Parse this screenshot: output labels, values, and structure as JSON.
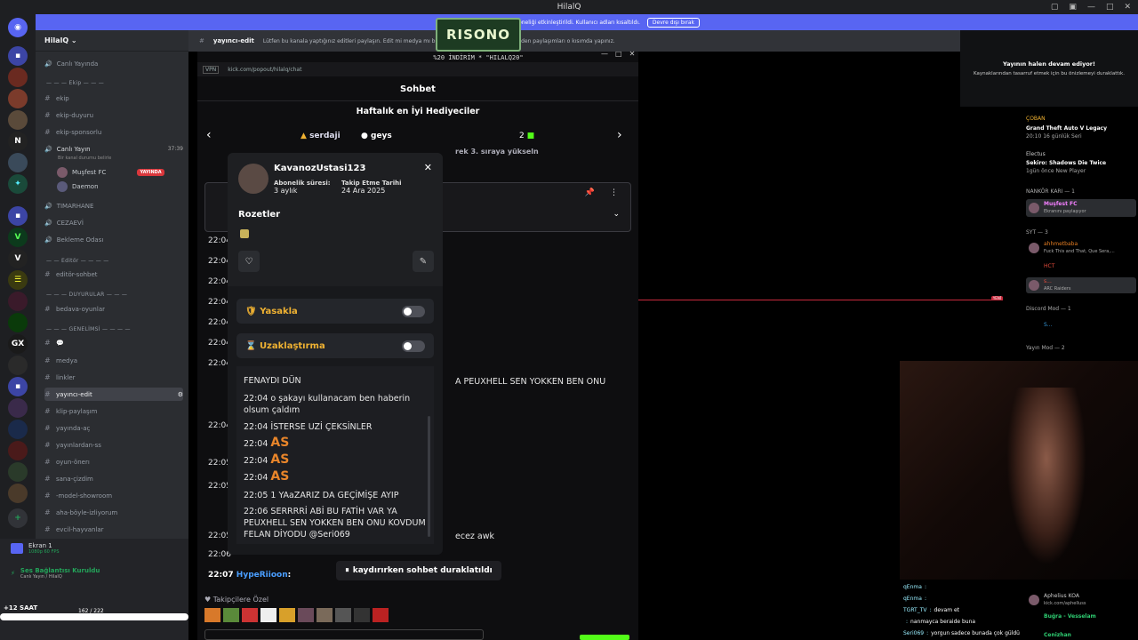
{
  "window": {
    "title": "HilalQ"
  },
  "banner": {
    "text": "Sunucunuzun aboneliği etkinleştirildi. Kullanıcı adları kısaltıldı.",
    "button": "Devre dışı bırak"
  },
  "server": {
    "name": "HilalQ"
  },
  "channels": {
    "live_header": "Canlı Yayında",
    "cat_ekip": "Ekip",
    "ekip": "ekip",
    "ekip_duyuru": "ekip-duyuru",
    "ekip_sponsorlu": "ekip-sponsorlu",
    "canli_yayin": "Canlı Yayın",
    "canli_yayin_sub": "Bir kanal durumu belirle",
    "canli_yayin_time": "37:39",
    "user1": "Muşfest FC",
    "user1_badge": "YAYINDA",
    "user2": "Daemon",
    "timarhane": "TIMARHANE",
    "cezaevi": "CEZAEVİ",
    "bekleme": "Bekleme Odası",
    "cat_editor": "Editör",
    "editor_sohbet": "editör-sohbet",
    "cat_duyurular": "DUYURULAR",
    "bedava": "bedava-oyunlar",
    "cat_genel": "GENELİMSİ",
    "medya": "medya",
    "linkler": "linkler",
    "yayinci_edit": "yayıncı-edit",
    "klip": "klip-paylaşım",
    "yayinda_ac": "yayında-aç",
    "yayinlardan": "yayınlardan-ss",
    "oyun_oneri": "oyun-önerı",
    "sana_cizdim": "sana-çizdim",
    "model": "-model-showroom",
    "aha": "aha-böyle-izliyorum",
    "evcil": "evcil-hayvanlar"
  },
  "user_panel": {
    "screen": "Ekran 1",
    "screen_sub": "1080p 60 FPS",
    "voice": "Ses Bağlantısı Kuruldu",
    "voice_sub": "Canlı Yayın / HilalQ",
    "timer_label": "+12 SAAT",
    "count": "162 / 222"
  },
  "topbar": {
    "channel": "yayıncı-edit",
    "topic": "Lütfen bu kanala yaptığınız editleri paylaşın. Edit mi medya mı büyük ihtimalle medyadır. Bu yüzden paylaşımları o kısımda yapınız."
  },
  "browser": {
    "url": "kick.com/popout/hilalq/chat"
  },
  "overlay": {
    "logo_text": "RISONO",
    "promo": "%20 İNDİRİM * \"HILALQ20\""
  },
  "chat": {
    "title": "Sohbet",
    "gifters_title": "Haftalık en İyi Hediyeciler",
    "gifter1": "serdaji",
    "gifter2": "geys",
    "gifter3_count": "2",
    "gifter_sub": "rek 3. sıraya yükseln",
    "paused": "kaydırırken sohbet duraklatıldı",
    "last_time": "22:07",
    "last_user": "HypeRiioon",
    "followers_only": "Takipçilere Özel",
    "right_line1": "A PEUXHELL SEN YOKKEN BEN ONU",
    "right_line2": "ecez awk",
    "times": [
      "22:04",
      "22:04",
      "22:04",
      "22:04",
      "22:04",
      "22:04",
      "22:04",
      "22:04",
      "22:05",
      "22:05",
      "22:05",
      "22:06"
    ]
  },
  "modal": {
    "username": "KavanozUstasi123",
    "sub_label": "Abonelik süresi:",
    "sub_value": "3 aylık",
    "follow_label": "Takip Etme Tarihi",
    "follow_value": "24 Ara 2025",
    "badges_title": "Rozetler",
    "ban": "Yasakla",
    "timeout": "Uzaklaştırma",
    "messages": [
      {
        "time": "",
        "text": "FENAYDI DÜN"
      },
      {
        "time": "22:04",
        "text": "o şakayı kullanacam ben haberin olsum çaldım"
      },
      {
        "time": "22:04",
        "text": "İSTERSE UZİ ÇEKSİNLER"
      },
      {
        "time": "22:04",
        "text": "AS"
      },
      {
        "time": "22:04",
        "text": "AS"
      },
      {
        "time": "22:04",
        "text": "AS"
      },
      {
        "time": "22:05",
        "text": "1 YAaZARIZ DA GEÇİMİŞE AYIP"
      },
      {
        "time": "22:06",
        "text": "SERRRRİ ABİ BU FATİH VAR YA PEUXHELL SEN YOKKEN BEN ONU KOVDUM FELAN DİYODU @Seri069"
      }
    ]
  },
  "right": {
    "warn_title": "Yayının halen devam ediyor!",
    "warn_body": "Kaynaklarından tasarruf etmek için bu önizlemeyi duraklattık.",
    "act1_name": "ÇOBAN",
    "act1_game": "Grand Theft Auto V Legacy",
    "act1_time": "20:10",
    "act1_sub": "16 günlük Seri",
    "act2_name": "Electus",
    "act2_game": "Sekiro: Shadows Die Twice",
    "act2_time": "1gün önce",
    "act2_sub": "New Player",
    "role1": "NANKÖR KARI — 1",
    "member1": "Muşfest FC",
    "member1_sub": "Ekranını paylaşıyor",
    "role2": "SYT — 3",
    "member2": "ahhmetbaba",
    "member2_sub": "Fuck This and That, Que Sera,...",
    "member3": "HCT",
    "member4": "s...",
    "member4_sub": "ARC Raiders",
    "role3": "Discord Mod — 1",
    "member5": "S...",
    "role4": "Yayın Mod — 2",
    "new_label": "YENİ",
    "member6": "Aphelius",
    "member6_tag": "KOA",
    "member6_sub": "kick.com/aphelluss",
    "member7": "Buğra - Vesselam",
    "member8": "Cenizhan"
  },
  "overlay_chat": [
    {
      "user": "qEnma",
      "text": ""
    },
    {
      "user": "qEnma",
      "text": ""
    },
    {
      "user": "TGRT_TV",
      "text": "devam et"
    },
    {
      "user": "",
      "text": "nanmayca beraide buna"
    },
    {
      "user": "Seri069",
      "text": "yorgun sadece bunada çok güldü"
    }
  ]
}
